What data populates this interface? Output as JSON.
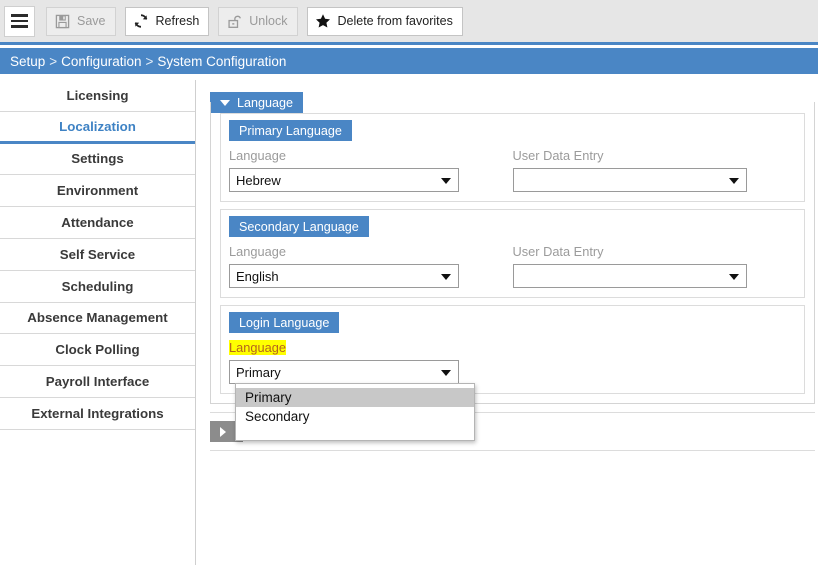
{
  "toolbar": {
    "menu_icon": "hamburger-icon",
    "buttons": [
      {
        "label": "Save",
        "icon": "floppy-disk-icon",
        "disabled": true
      },
      {
        "label": "Refresh",
        "icon": "refresh-circular-arrows-icon",
        "disabled": false
      },
      {
        "label": "Unlock",
        "icon": "open-padlock-icon",
        "disabled": true
      },
      {
        "label": "Delete from favorites",
        "icon": "star-filled-icon",
        "disabled": false
      }
    ]
  },
  "breadcrumb": {
    "items": [
      "Setup",
      "Configuration",
      "System Configuration"
    ],
    "separator": ">"
  },
  "sidebar": {
    "items": [
      {
        "label": "Licensing",
        "active": false
      },
      {
        "label": "Localization",
        "active": true
      },
      {
        "label": "Settings",
        "active": false
      },
      {
        "label": "Environment",
        "active": false
      },
      {
        "label": "Attendance",
        "active": false
      },
      {
        "label": "Self Service",
        "active": false
      },
      {
        "label": "Scheduling",
        "active": false
      },
      {
        "label": "Absence Management",
        "active": false
      },
      {
        "label": "Clock Polling",
        "active": false
      },
      {
        "label": "Payroll Interface",
        "active": false
      },
      {
        "label": "External Integrations",
        "active": false
      }
    ]
  },
  "main": {
    "section_language": {
      "title": "Language",
      "expanded": true,
      "primary": {
        "title": "Primary Language",
        "language_label": "Language",
        "language_value": "Hebrew",
        "user_data_entry_label": "User Data Entry",
        "user_data_entry_value": ""
      },
      "secondary": {
        "title": "Secondary Language",
        "language_label": "Language",
        "language_value": "English",
        "user_data_entry_label": "User Data Entry",
        "user_data_entry_value": ""
      },
      "login": {
        "title": "Login Language",
        "language_label": "Language",
        "language_value": "Primary",
        "label_highlighted": true,
        "dropdown_open": true,
        "options": [
          {
            "label": "Primary",
            "selected": true
          },
          {
            "label": "Secondary",
            "selected": false
          }
        ]
      }
    },
    "collapsed_section": {
      "title": "",
      "expanded": false
    }
  },
  "colors": {
    "accent_blue": "#4a86c5",
    "active_link_blue": "#3e82c4",
    "toolbar_bg": "#e6e6e6",
    "highlight_yellow": "#ffff00",
    "highlight_text": "#b5651d",
    "collapsed_gray": "#8c8c8c",
    "option_selected_gray": "#c8c8c8"
  }
}
